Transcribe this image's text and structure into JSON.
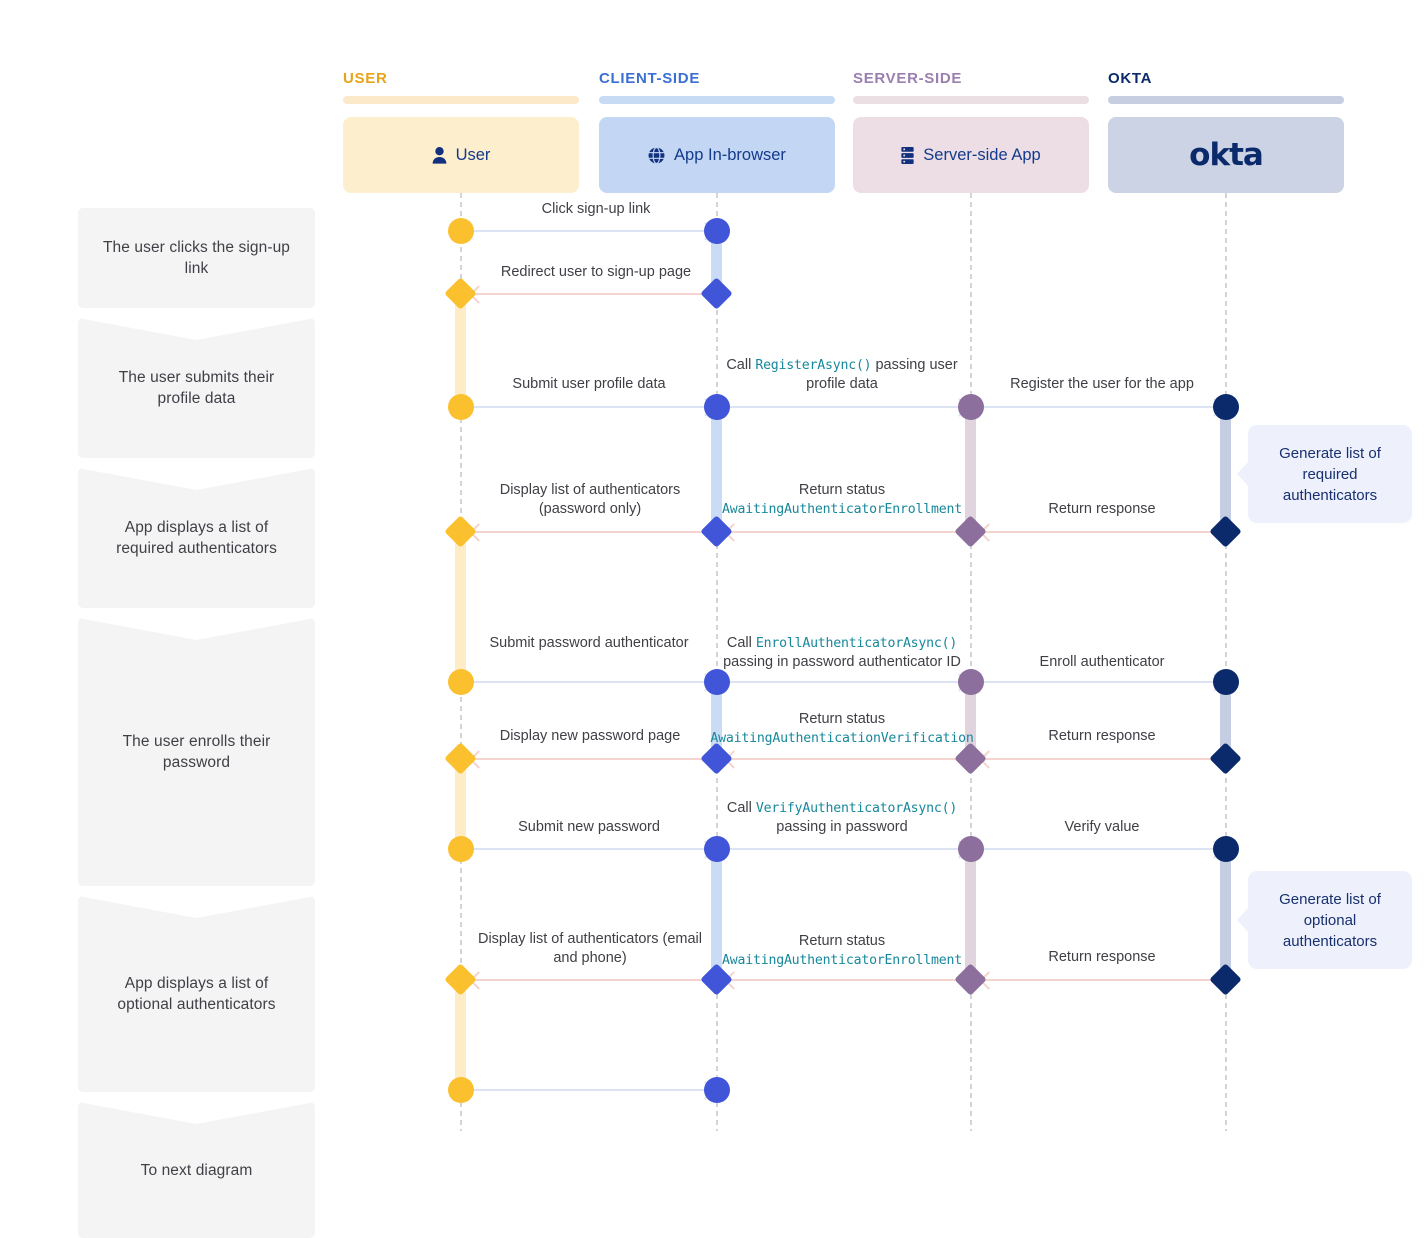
{
  "steps": [
    {
      "label": "The user clicks the sign-up link"
    },
    {
      "label": "The user submits their profile data"
    },
    {
      "label": "App displays a list of required authenticators"
    },
    {
      "label": "The user enrolls their password"
    },
    {
      "label": "App displays a list of optional authenticators"
    },
    {
      "label": "To next diagram"
    }
  ],
  "columns": [
    {
      "title": "USER",
      "box_label": "User",
      "icon": "person-icon",
      "title_color": "#e8a317",
      "bar_color": "#fbe9c9",
      "box_color": "#fdeecd"
    },
    {
      "title": "CLIENT-SIDE",
      "box_label": "App In-browser",
      "icon": "globe-icon",
      "title_color": "#3b6fd4",
      "bar_color": "#c8dbf5",
      "box_color": "#c3d7f5"
    },
    {
      "title": "SERVER-SIDE",
      "box_label": "Server-side App",
      "icon": "server-icon",
      "title_color": "#9b7fae",
      "bar_color": "#ecdfe4",
      "box_color": "#ecdee4"
    },
    {
      "title": "OKTA",
      "box_label": "okta",
      "icon": "okta-logo",
      "title_color": "#0b2a6b",
      "bar_color": "#c7cee1",
      "box_color": "#ccd3e4"
    }
  ],
  "messages": [
    {
      "id": "m1",
      "text": "Click sign-up link"
    },
    {
      "id": "m2",
      "text": "Redirect user to sign-up page"
    },
    {
      "id": "m3",
      "text": "Submit user profile data"
    },
    {
      "id": "m4",
      "pre": "Call ",
      "code": "RegisterAsync()",
      "post": " passing user profile data"
    },
    {
      "id": "m5",
      "text": "Register the user for the app"
    },
    {
      "id": "m6",
      "text": "Display list of authenticators (password only)"
    },
    {
      "id": "m7",
      "pre": "Return status",
      "code": "AwaitingAuthenticatorEnrollment",
      "post": ""
    },
    {
      "id": "m8",
      "text": "Return response"
    },
    {
      "id": "m9",
      "text": "Submit password authenticator"
    },
    {
      "id": "m10",
      "pre": "Call ",
      "code": "EnrollAuthenticatorAsync()",
      "post": " passing in password authenticator ID"
    },
    {
      "id": "m11",
      "text": "Enroll authenticator"
    },
    {
      "id": "m12",
      "text": "Display new password page"
    },
    {
      "id": "m13",
      "pre": "Return status",
      "code": "AwaitingAuthenticationVerification",
      "post": ""
    },
    {
      "id": "m14",
      "text": "Return response"
    },
    {
      "id": "m15",
      "text": "Submit new password"
    },
    {
      "id": "m16",
      "pre": "Call ",
      "code": "VerifyAuthenticatorAsync()",
      "post": " passing in password"
    },
    {
      "id": "m17",
      "text": "Verify value"
    },
    {
      "id": "m18",
      "text": "Display list of authenticators (email and phone)"
    },
    {
      "id": "m19",
      "pre": "Return status",
      "code": "AwaitingAuthenticatorEnrollment",
      "post": ""
    },
    {
      "id": "m20",
      "text": "Return response"
    }
  ],
  "callouts": [
    {
      "id": "c1",
      "text": "Generate list of required authenticators"
    },
    {
      "id": "c2",
      "text": "Generate list of optional authenticators"
    }
  ],
  "colors": {
    "user": "#fbc02d",
    "client": "#4055d8",
    "server": "#8c6f9c",
    "okta": "#0b2a6b",
    "arrow_forward": "#dce3f2",
    "arrow_return": "#f5d3ce",
    "lifeline": "#d4d4d8",
    "step_bg": "#f4f4f5"
  }
}
